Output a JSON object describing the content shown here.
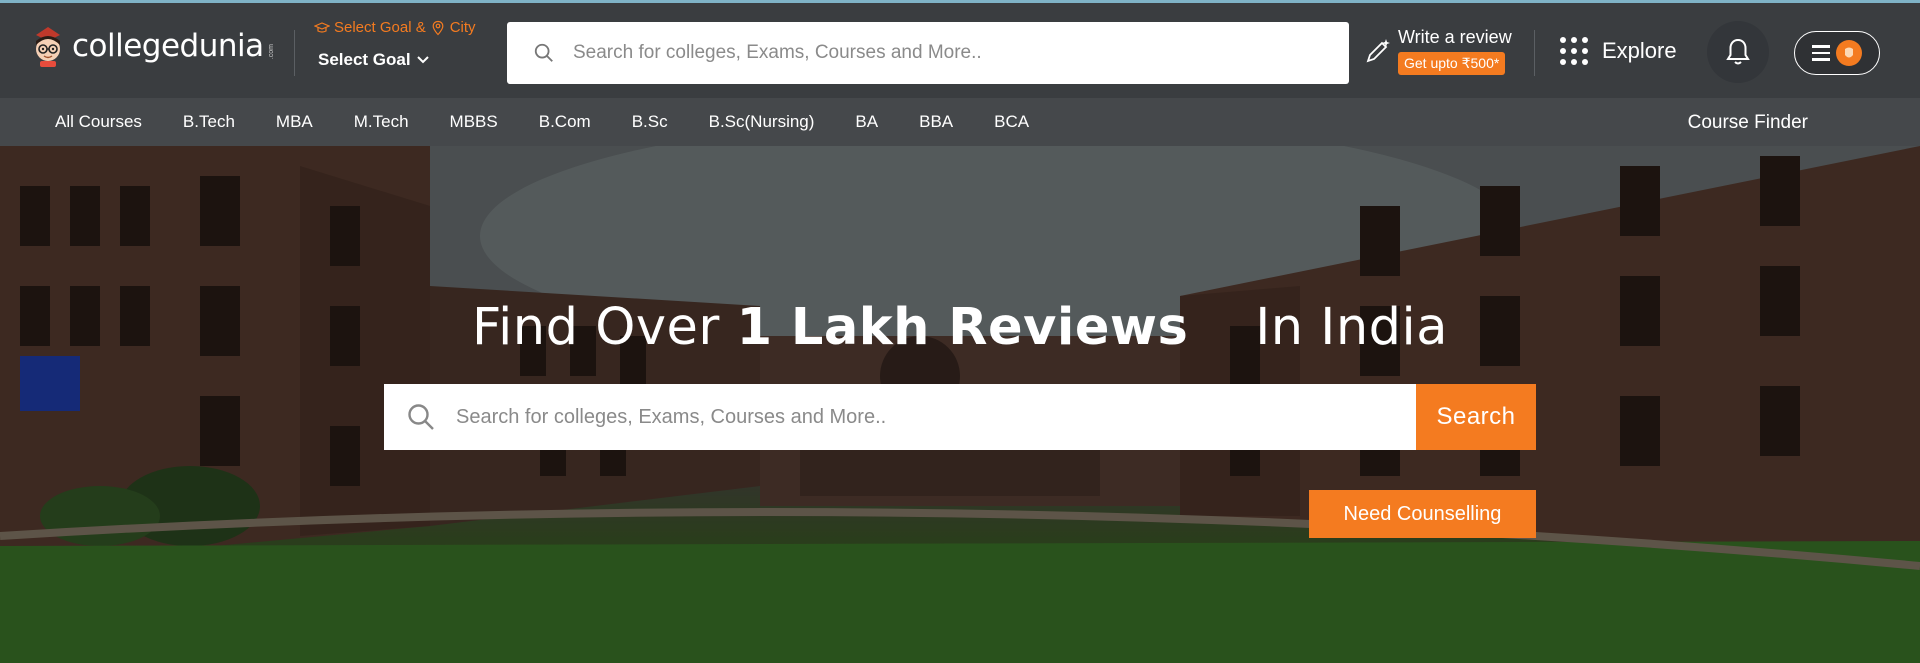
{
  "header": {
    "logo_text": "collegedunia",
    "logo_suffix": ".com",
    "goal": {
      "top_label_goal": "Select Goal &",
      "top_label_city": "City",
      "select_label": "Select Goal"
    },
    "search": {
      "placeholder": "Search for colleges, Exams, Courses and More.."
    },
    "review": {
      "label": "Write a review",
      "badge": "Get upto ₹500*"
    },
    "explore_label": "Explore"
  },
  "courses": {
    "items": [
      "All Courses",
      "B.Tech",
      "MBA",
      "M.Tech",
      "MBBS",
      "B.Com",
      "B.Sc",
      "B.Sc(Nursing)",
      "BA",
      "BBA",
      "BCA"
    ],
    "finder_label": "Course Finder"
  },
  "hero": {
    "title_prefix": "Find Over",
    "title_highlight": "1 Lakh Reviews",
    "title_suffix": "In India",
    "search_placeholder": "Search for colleges, Exams, Courses and More..",
    "search_button": "Search",
    "counselling_button": "Need Counselling"
  },
  "colors": {
    "accent": "#f47b20",
    "header_bg": "#3a3d40",
    "nav_bg": "#45484b"
  },
  "icons": [
    "mascot-logo-icon",
    "graduation-cap-icon",
    "location-pin-icon",
    "chevron-down-icon",
    "search-icon",
    "pencil-sparkle-icon",
    "grid-dots-icon",
    "bell-icon",
    "hamburger-icon",
    "user-avatar-icon"
  ]
}
